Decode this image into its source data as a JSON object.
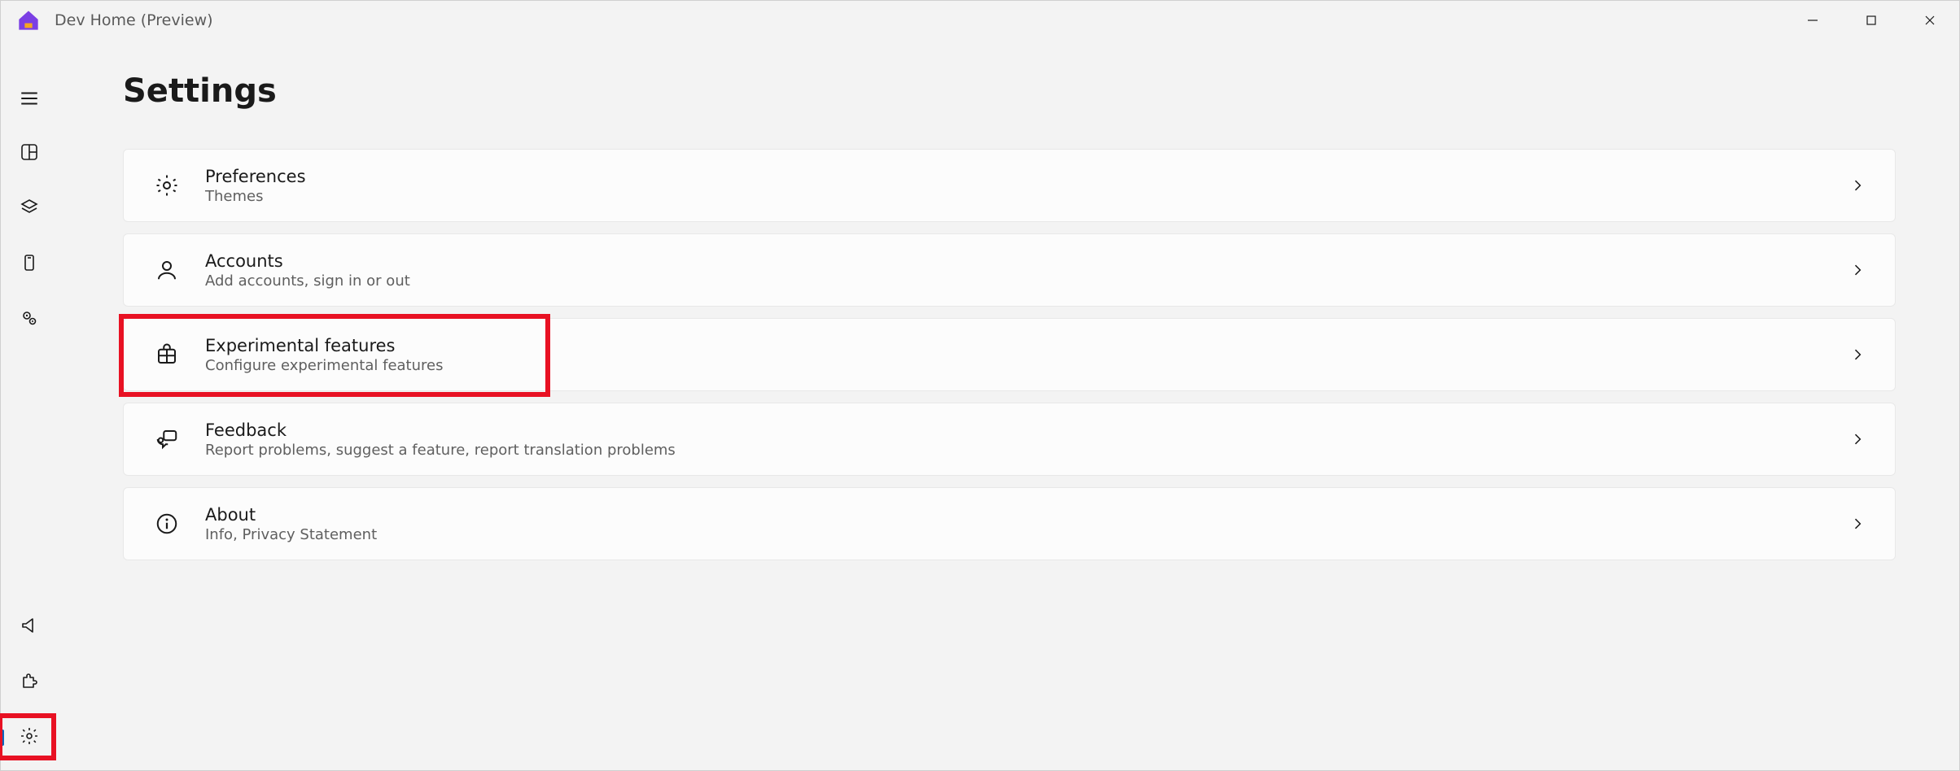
{
  "window": {
    "title": "Dev Home (Preview)"
  },
  "page": {
    "title": "Settings"
  },
  "sidebar": {
    "top": [
      {
        "name": "hamburger-icon"
      },
      {
        "name": "dashboard-icon"
      },
      {
        "name": "layers-icon"
      },
      {
        "name": "device-icon"
      },
      {
        "name": "gears-icon"
      }
    ],
    "bottom": [
      {
        "name": "megaphone-icon"
      },
      {
        "name": "puzzle-icon"
      },
      {
        "name": "settings-icon",
        "active": true
      }
    ]
  },
  "settings_items": [
    {
      "icon": "gear-icon",
      "title": "Preferences",
      "desc": "Themes"
    },
    {
      "icon": "person-icon",
      "title": "Accounts",
      "desc": "Add accounts, sign in or out"
    },
    {
      "icon": "experimental-icon",
      "title": "Experimental features",
      "desc": "Configure experimental features",
      "highlighted": true
    },
    {
      "icon": "feedback-icon",
      "title": "Feedback",
      "desc": "Report problems, suggest a feature, report translation problems"
    },
    {
      "icon": "info-icon",
      "title": "About",
      "desc": "Info, Privacy Statement"
    }
  ],
  "highlights": {
    "sidebar_settings": true,
    "experimental_card": true
  }
}
